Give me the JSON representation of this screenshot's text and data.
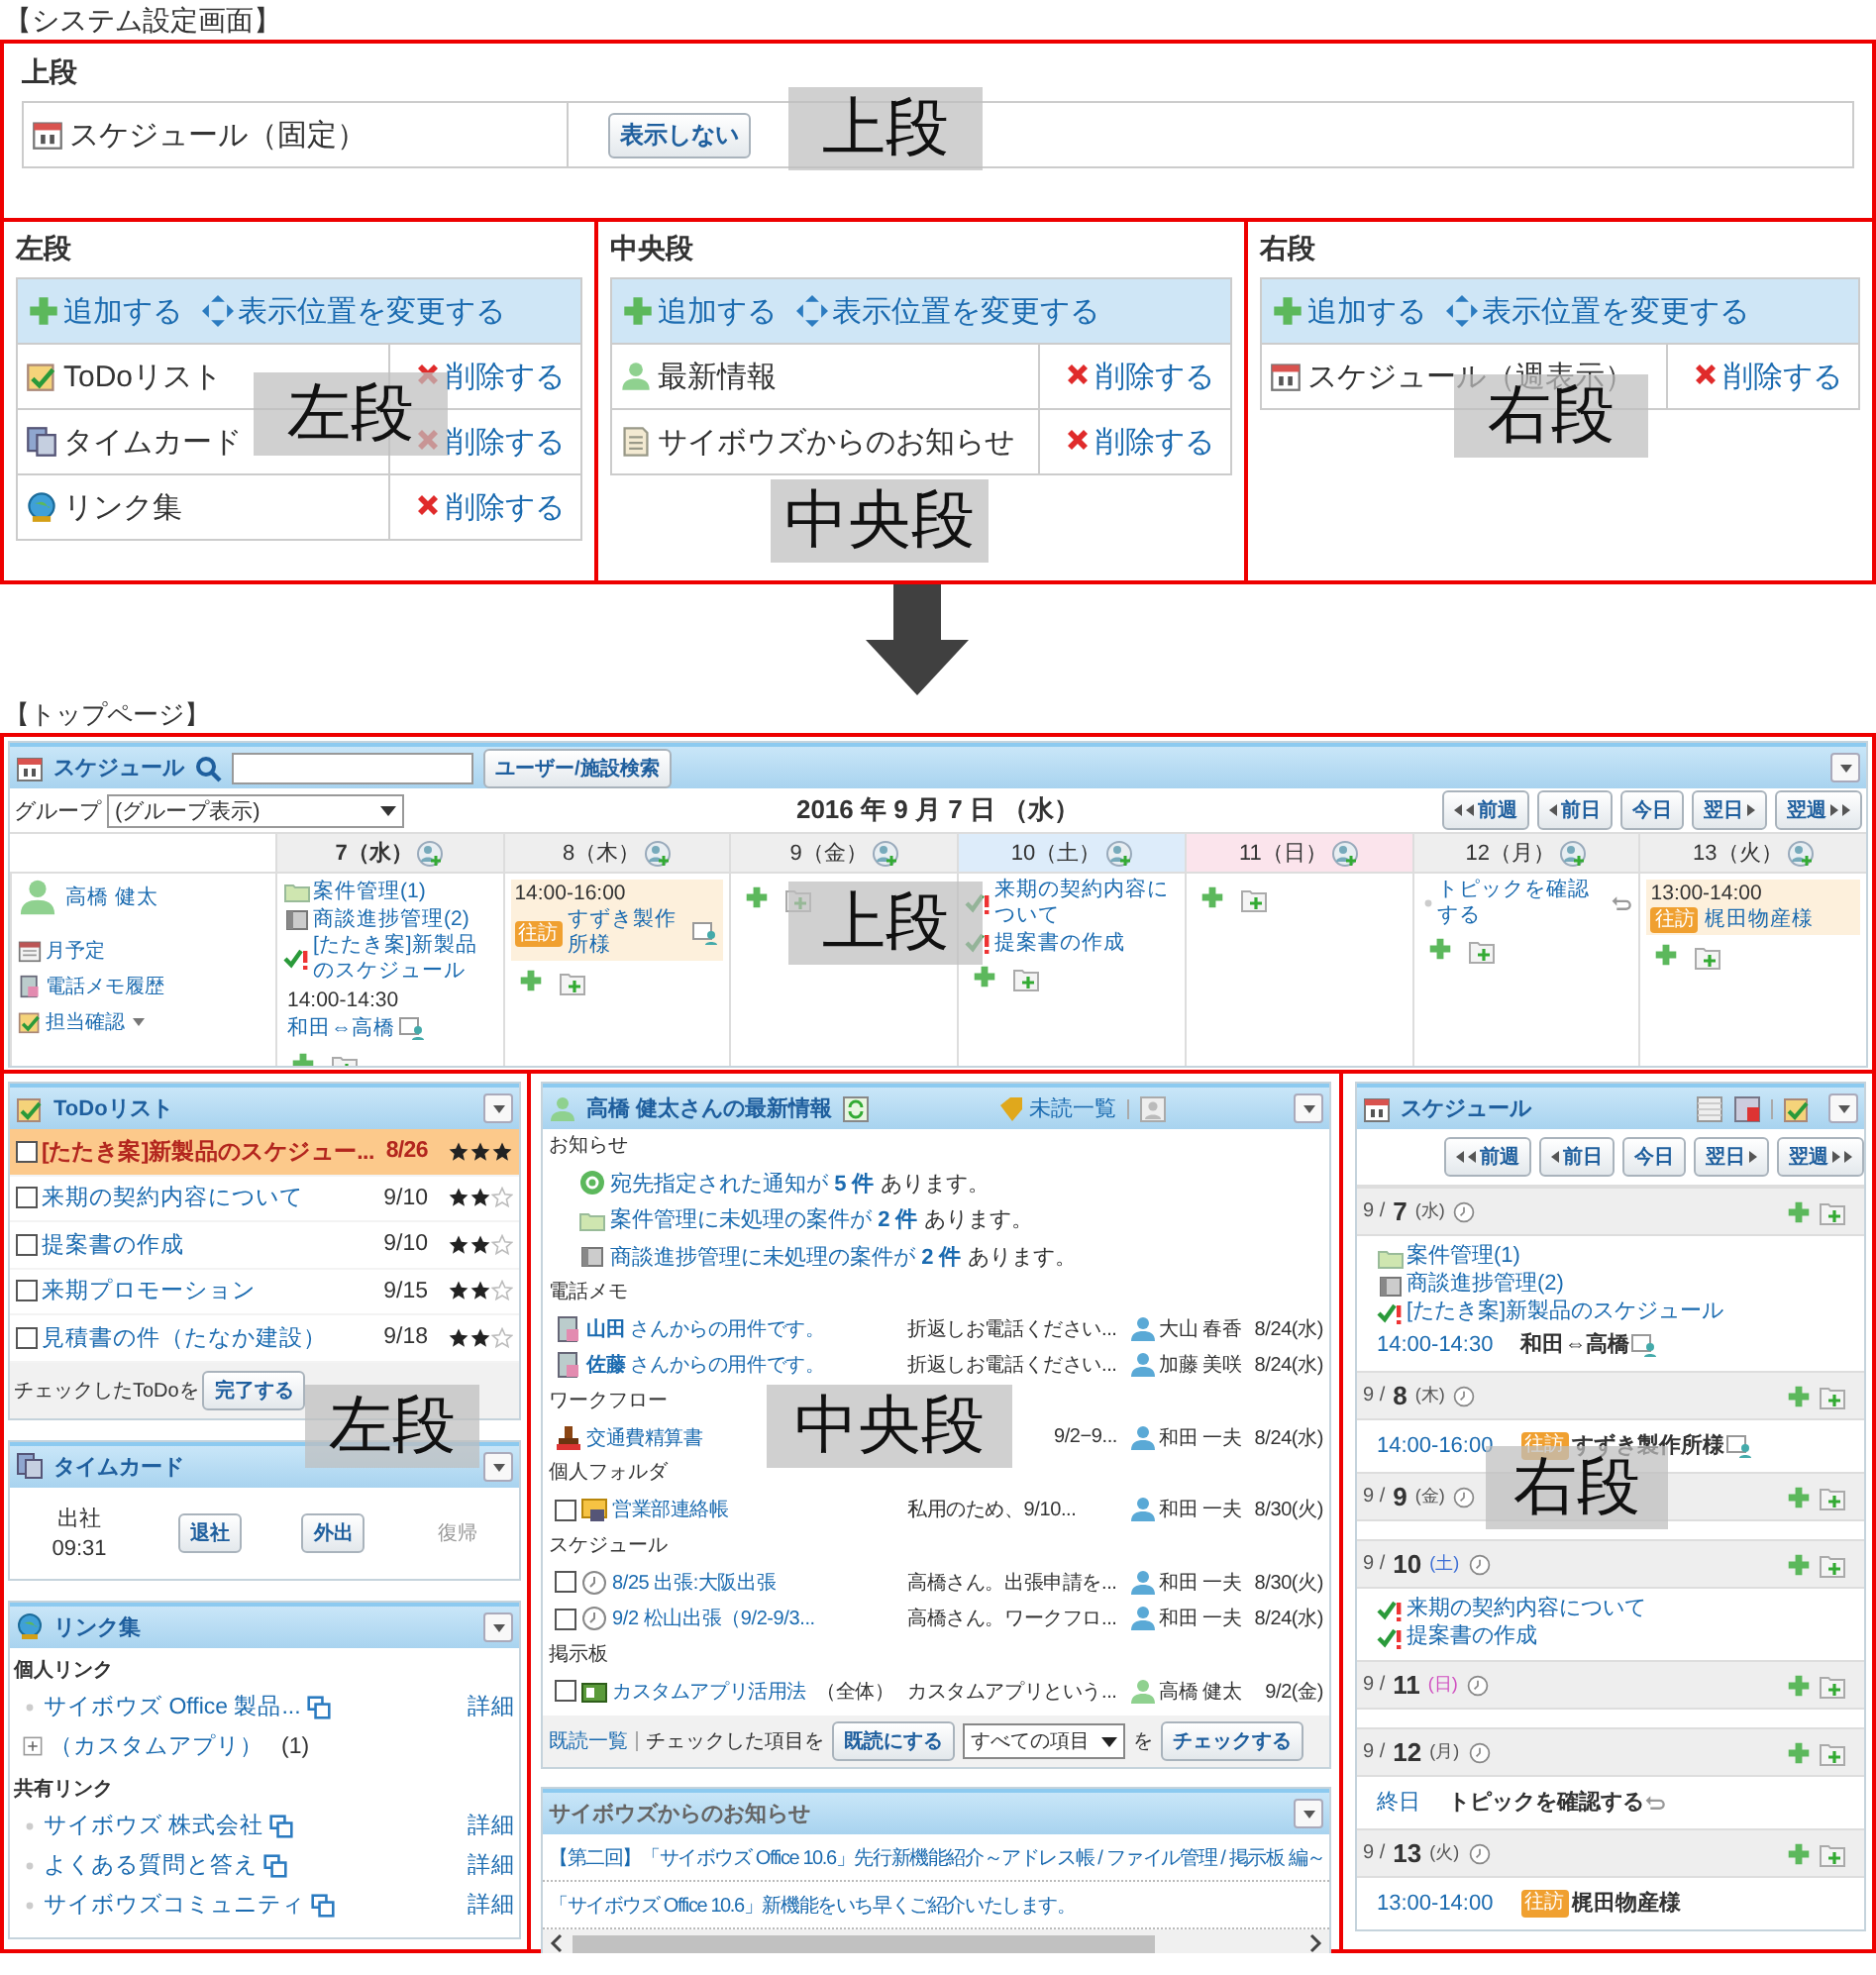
{
  "system_settings": {
    "caption": "【システム設定画面】",
    "top_section": {
      "heading": "上段",
      "label_overlay": "上段",
      "items": [
        {
          "kind": "schedule",
          "label": "スケジュール（固定）",
          "button": "表示しない"
        }
      ]
    },
    "columns": [
      {
        "heading": "左段",
        "label_overlay": "左段",
        "add": "追加する",
        "reorder": "表示位置を変更する",
        "items": [
          {
            "kind": "todo",
            "label": "ToDoリスト",
            "delete": "削除する"
          },
          {
            "kind": "timecard",
            "label": "タイムカード",
            "delete": "削除する"
          },
          {
            "kind": "links",
            "label": "リンク集",
            "delete": "削除する"
          }
        ]
      },
      {
        "heading": "中央段",
        "label_overlay": "中央段",
        "add": "追加する",
        "reorder": "表示位置を変更する",
        "items": [
          {
            "kind": "latest",
            "label": "最新情報",
            "delete": "削除する"
          },
          {
            "kind": "news",
            "label": "サイボウズからのお知らせ",
            "delete": "削除する"
          }
        ]
      },
      {
        "heading": "右段",
        "label_overlay": "右段",
        "add": "追加する",
        "reorder": "表示位置を変更する",
        "items": [
          {
            "kind": "schedule",
            "label": "スケジュール（週表示）",
            "delete": "削除する"
          }
        ]
      }
    ]
  },
  "top_page": {
    "caption": "【トップページ】",
    "schedule": {
      "title": "スケジュール",
      "search_button": "ユーザー/施設検索",
      "group_label": "グループ",
      "group_select": "(グループ表示)",
      "date": "2016 年 9 月 7 日 （水）",
      "label_overlay": "上段",
      "nav": [
        {
          "label": "前週",
          "kind": "prev-week"
        },
        {
          "label": "前日",
          "kind": "prev-day"
        },
        {
          "label": "今日",
          "kind": "today"
        },
        {
          "label": "翌日",
          "kind": "next-day"
        },
        {
          "label": "翌週",
          "kind": "next-week"
        }
      ],
      "user": {
        "name": "高橋 健太",
        "links": [
          {
            "label": "月予定",
            "kind": "monthly",
            "menu": false
          },
          {
            "label": "電話メモ履歴",
            "kind": "phone-memo",
            "menu": false
          },
          {
            "label": "担当確認",
            "kind": "assignee",
            "menu": true
          }
        ]
      },
      "days": [
        {
          "label": "7（水）",
          "kind": "today",
          "entries": [
            {
              "kind": "case",
              "text": "案件管理(1)"
            },
            {
              "kind": "deal",
              "text": "商談進捗管理(2)"
            },
            {
              "kind": "todo",
              "text": "[たたき案]新製品のスケジュール"
            },
            {
              "kind": "event",
              "time": "14:00-14:30",
              "text": "和田⇔高橋",
              "highlighted": false,
              "shared": true
            }
          ]
        },
        {
          "label": "8（木）",
          "kind": "weekday",
          "entries": [
            {
              "kind": "event",
              "time": "14:00-16:00",
              "tag": "往訪",
              "text": "すずき製作所様",
              "highlighted": true,
              "shared": true
            }
          ]
        },
        {
          "label": "9（金）",
          "kind": "weekday"
        },
        {
          "label": "10（土）",
          "kind": "saturday",
          "entries": [
            {
              "kind": "todo",
              "text": "来期の契約内容について"
            },
            {
              "kind": "todo",
              "text": "提案書の作成"
            }
          ]
        },
        {
          "label": "11（日）",
          "kind": "sunday"
        },
        {
          "label": "12（月）",
          "kind": "weekday",
          "entries": [
            {
              "kind": "topic",
              "text": "トピックを確認する"
            }
          ]
        },
        {
          "label": "13（火）",
          "kind": "weekday",
          "entries": [
            {
              "kind": "event",
              "time": "13:00-14:00",
              "tag": "往訪",
              "text": "梶田物産様",
              "highlighted": true,
              "shared": false
            }
          ]
        }
      ]
    },
    "left": {
      "label_overlay": "左段",
      "todo": {
        "title": "ToDoリスト",
        "items": [
          {
            "text": "[たたき案]新製品のスケジュー...",
            "date": "8/26",
            "stars": 3,
            "overdue": true,
            "checked": false
          },
          {
            "text": "来期の契約内容について",
            "date": "9/10",
            "stars": 2,
            "overdue": false,
            "checked": false
          },
          {
            "text": "提案書の作成",
            "date": "9/10",
            "stars": 2,
            "overdue": false,
            "checked": false
          },
          {
            "text": "来期プロモーション",
            "date": "9/15",
            "stars": 2,
            "overdue": false,
            "checked": false
          },
          {
            "text": "見積書の件（たなか建設）",
            "date": "9/18",
            "stars": 2,
            "overdue": false,
            "checked": false
          }
        ],
        "footer_label": "チェックしたToDoを",
        "complete_button": "完了する"
      },
      "timecard": {
        "title": "タイムカード",
        "status": "出社",
        "time": "09:31",
        "buttons": [
          {
            "label": "退社",
            "disabled": false
          },
          {
            "label": "外出",
            "disabled": false
          },
          {
            "label": "復帰",
            "disabled": true
          }
        ]
      },
      "links": {
        "title": "リンク集",
        "groups": [
          {
            "heading": "個人リンク",
            "items": [
              {
                "kind": "link",
                "text": "サイボウズ Office 製品...",
                "detail": "詳細"
              },
              {
                "kind": "folder",
                "text": "（カスタムアプリ）",
                "count": "(1)"
              }
            ]
          },
          {
            "heading": "共有リンク",
            "items": [
              {
                "kind": "link",
                "text": "サイボウズ 株式会社",
                "detail": "詳細"
              },
              {
                "kind": "link",
                "text": "よくある質問と答え",
                "detail": "詳細"
              },
              {
                "kind": "link",
                "text": "サイボウズコミュニティ",
                "detail": "詳細"
              }
            ]
          }
        ]
      }
    },
    "center": {
      "label_overlay": "中央段",
      "latest": {
        "title": "高橋 健太さんの最新情報",
        "unread": "未読一覧",
        "sections": [
          {
            "heading": "お知らせ",
            "rows": [
              {
                "kind": "mention",
                "link": "宛先指定された通知が",
                "count": "5 件",
                "rest": "あります。"
              },
              {
                "kind": "case",
                "link": "案件管理に未処理の案件が",
                "count": "2 件",
                "rest": "あります。"
              },
              {
                "kind": "deal",
                "link": "商談進捗管理に未処理の案件が",
                "count": "2 件",
                "rest": "あります。"
              }
            ]
          },
          {
            "heading": "電話メモ",
            "rows": [
              {
                "kind": "phone",
                "caller": "山田",
                "title": "さんからの用件です。",
                "summary": "折返しお電話ください...",
                "person": "大山 春香",
                "self": false,
                "date": "8/24(水)"
              },
              {
                "kind": "phone",
                "caller": "佐藤",
                "title": "さんからの用件です。",
                "summary": "折返しお電話ください...",
                "person": "加藤 美咲",
                "self": false,
                "date": "8/24(水)"
              }
            ]
          },
          {
            "heading": "ワークフロー",
            "rows": [
              {
                "kind": "workflow",
                "title": "交通費精算書",
                "summary": "9/2−9...",
                "person": "和田 一夫",
                "self": false,
                "date": "8/24(水)"
              }
            ]
          },
          {
            "heading": "個人フォルダ",
            "rows": [
              {
                "kind": "folder",
                "checked": false,
                "title": "営業部連絡帳",
                "summary": "私用のため、9/10...",
                "person": "和田 一夫",
                "self": false,
                "date": "8/30(火)"
              }
            ]
          },
          {
            "heading": "スケジュール",
            "rows": [
              {
                "kind": "schedule",
                "checked": false,
                "title": "8/25 出張:大阪出張",
                "summary": "高橋さん。出張申請を...",
                "person": "和田 一夫",
                "self": false,
                "date": "8/30(火)"
              },
              {
                "kind": "schedule",
                "checked": false,
                "title": "9/2 松山出張（9/2-9/3...",
                "summary": "高橋さん。ワークフロ...",
                "person": "和田 一夫",
                "self": false,
                "date": "8/24(水)"
              }
            ]
          },
          {
            "heading": "掲示板",
            "rows": [
              {
                "kind": "board",
                "checked": false,
                "title": "カスタムアプリ活用法",
                "note": "（全体）",
                "summary": "カスタムアプリという...",
                "person": "高橋 健太",
                "self": true,
                "date": "9/2(金)"
              }
            ]
          }
        ],
        "footer": {
          "read_list": "既読一覧",
          "checked_label": "チェックした項目を",
          "mark_read": "既読にする",
          "scope": "すべての項目",
          "particle": "を",
          "check": "チェックする"
        }
      },
      "news": {
        "title": "サイボウズからのお知らせ",
        "items": [
          "【第二回】「サイボウズ Office 10.6」先行新機能紹介～アドレス帳 / ファイル管理 / 掲示板 編～",
          "「サイボウズ Office 10.6」新機能をいち早くご紹介いたします。"
        ]
      }
    },
    "right": {
      "label_overlay": "右段",
      "title": "スケジュール",
      "nav": [
        {
          "label": "前週",
          "kind": "prev-week"
        },
        {
          "label": "前日",
          "kind": "prev-day"
        },
        {
          "label": "今日",
          "kind": "today"
        },
        {
          "label": "翌日",
          "kind": "next-day"
        },
        {
          "label": "翌週",
          "kind": "next-week"
        }
      ],
      "days": [
        {
          "month": "9 /",
          "day": "7",
          "weekday": "(水)",
          "kind": "weekday",
          "entries": [
            {
              "kind": "case",
              "text": "案件管理(1)"
            },
            {
              "kind": "deal",
              "text": "商談進捗管理(2)"
            },
            {
              "kind": "todo",
              "text": "[たたき案]新製品のスケジュール"
            },
            {
              "kind": "event",
              "time": "14:00-14:30",
              "text": "和田⇔高橋",
              "shared": true
            }
          ]
        },
        {
          "month": "9 /",
          "day": "8",
          "weekday": "(木)",
          "kind": "weekday",
          "entries": [
            {
              "kind": "event",
              "time": "14:00-16:00",
              "tag": "往訪",
              "text": "すずき製作所様",
              "shared": true
            }
          ]
        },
        {
          "month": "9 /",
          "day": "9",
          "weekday": "(金)",
          "kind": "weekday"
        },
        {
          "month": "9 /",
          "day": "10",
          "weekday": "(土)",
          "kind": "saturday",
          "entries": [
            {
              "kind": "todo",
              "text": "来期の契約内容について"
            },
            {
              "kind": "todo",
              "text": "提案書の作成"
            }
          ]
        },
        {
          "month": "9 /",
          "day": "11",
          "weekday": "(日)",
          "kind": "sunday"
        },
        {
          "month": "9 /",
          "day": "12",
          "weekday": "(月)",
          "kind": "weekday",
          "entries": [
            {
              "kind": "topic",
              "time": "終日",
              "text": "トピックを確認する"
            }
          ]
        },
        {
          "month": "9 /",
          "day": "13",
          "weekday": "(火)",
          "kind": "weekday",
          "entries": [
            {
              "kind": "event",
              "time": "13:00-14:00",
              "tag": "往訪",
              "text": "梶田物産様",
              "shared": false
            }
          ]
        }
      ]
    }
  }
}
